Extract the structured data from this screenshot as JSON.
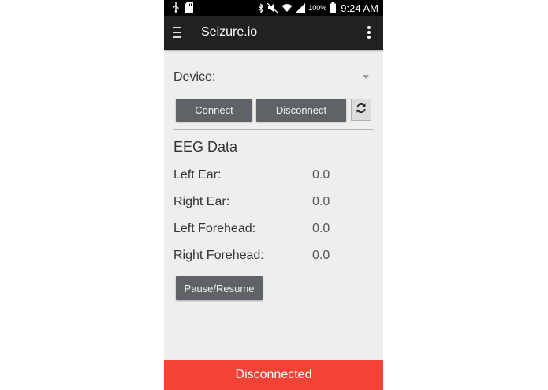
{
  "status_bar": {
    "battery_percent": "100%",
    "time": "9:24 AM"
  },
  "app_bar": {
    "title": "Seizure.io"
  },
  "device": {
    "label": "Device:",
    "selected_value": ""
  },
  "buttons": {
    "connect": "Connect",
    "disconnect": "Disconnect",
    "pause_resume": "Pause/Resume"
  },
  "eeg": {
    "heading": "EEG Data",
    "rows": [
      {
        "label": "Left Ear:",
        "value": "0.0"
      },
      {
        "label": "Right Ear:",
        "value": "0.0"
      },
      {
        "label": "Left Forehead:",
        "value": "0.0"
      },
      {
        "label": "Right Forehead:",
        "value": "0.0"
      }
    ]
  },
  "connection": {
    "status": "Disconnected"
  },
  "colors": {
    "app_bar": "#212121",
    "background": "#eeeeee",
    "button": "#5f6368",
    "status_disconnected": "#f44336"
  },
  "icons": [
    "usb-icon",
    "sd-card-icon",
    "bluetooth-icon",
    "mute-icon",
    "wifi-icon",
    "signal-icon",
    "battery-icon",
    "menu-icon",
    "overflow-menu-icon",
    "refresh-icon",
    "dropdown-arrow-icon"
  ]
}
